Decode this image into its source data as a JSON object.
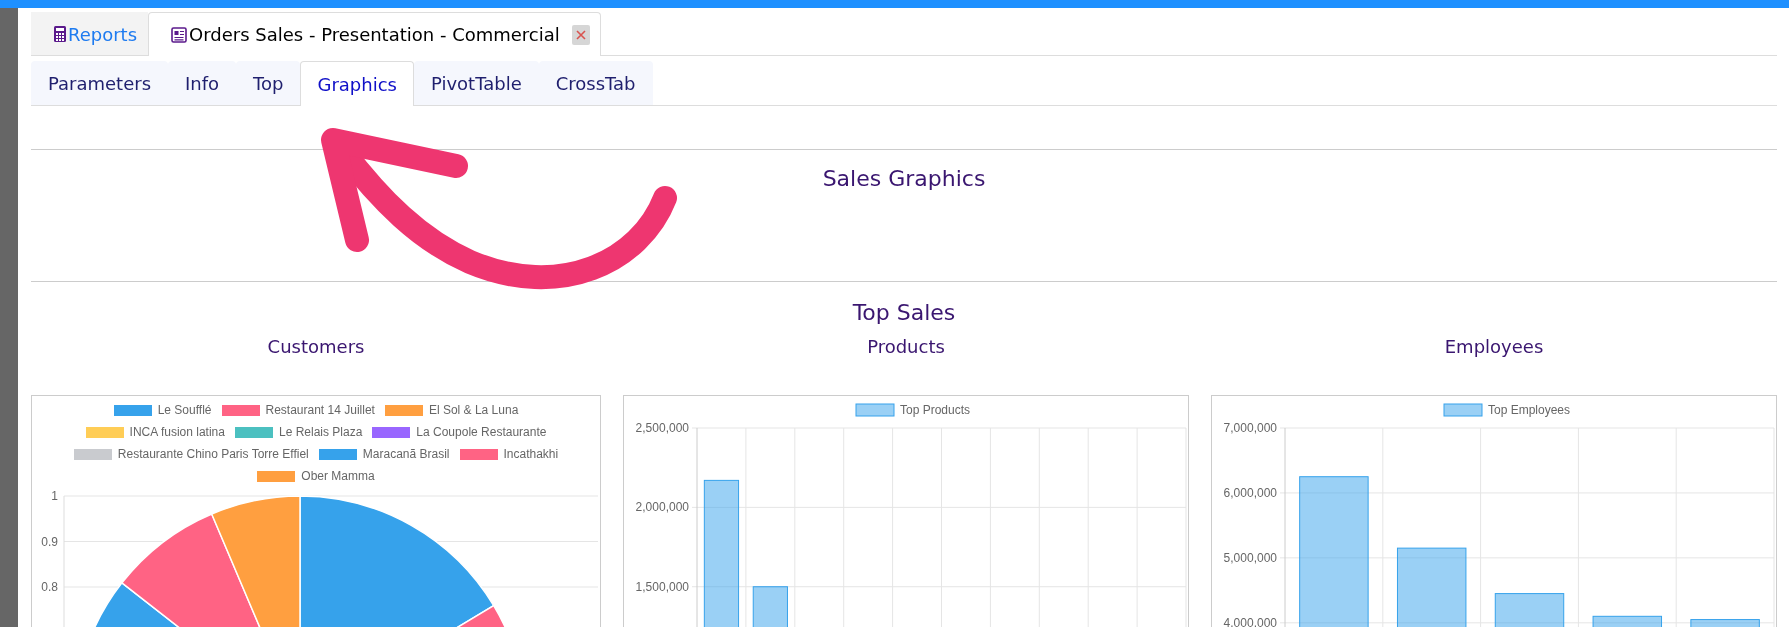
{
  "top_tabs": [
    {
      "label": "Reports",
      "selected": false,
      "closable": false
    },
    {
      "label": "Orders Sales - Presentation - Commercial",
      "selected": true,
      "closable": true
    }
  ],
  "sub_tabs": [
    {
      "label": "Parameters",
      "selected": false
    },
    {
      "label": "Info",
      "selected": false
    },
    {
      "label": "Top",
      "selected": false
    },
    {
      "label": "Graphics",
      "selected": true
    },
    {
      "label": "PivotTable",
      "selected": false
    },
    {
      "label": "CrossTab",
      "selected": false
    }
  ],
  "page_title": "Sales Graphics",
  "top_sales": {
    "title": "Top Sales",
    "customers": {
      "title": "Customers",
      "legend": [
        {
          "label": "Le Soufflé",
          "color": "#36a2eb"
        },
        {
          "label": "Restaurant 14 Juillet",
          "color": "#ff6384"
        },
        {
          "label": "El Sol & La Luna",
          "color": "#ff9f40"
        },
        {
          "label": "INCA fusion latina",
          "color": "#ffcd56"
        },
        {
          "label": "Le Relais Plaza",
          "color": "#4bc0c0"
        },
        {
          "label": "La Coupole Restaurante",
          "color": "#9966ff"
        },
        {
          "label": "Restaurante Chino Paris Torre Effiel",
          "color": "#c9cbcf"
        },
        {
          "label": "Maracanã Brasil",
          "color": "#36a2eb"
        },
        {
          "label": "Incathakhi",
          "color": "#ff6384"
        },
        {
          "label": "Ober Mamma",
          "color": "#ff9f40"
        }
      ],
      "axis_ticks": [
        "1",
        "0.9",
        "0.8"
      ]
    },
    "products": {
      "title": "Products",
      "chart_data": {
        "type": "bar",
        "grid": true,
        "ylim": [
          1240000,
          2500000
        ],
        "yticks": [
          {
            "value": 1500000,
            "label": "1,500,000"
          },
          {
            "value": 2000000,
            "label": "2,000,000"
          },
          {
            "value": 2500000,
            "label": "2,500,000"
          }
        ],
        "series": [
          {
            "name": "Top Products",
            "color": "#36a2eb",
            "values": [
              2170000,
              1500000,
              null,
              null,
              null,
              null,
              null,
              null,
              null,
              null
            ]
          }
        ]
      }
    },
    "employees": {
      "title": "Employees",
      "chart_data": {
        "type": "bar",
        "grid": true,
        "ylim": [
          3920000,
          7000000
        ],
        "yticks": [
          {
            "value": 4000000,
            "label": "4,000,000"
          },
          {
            "value": 5000000,
            "label": "5,000,000"
          },
          {
            "value": 6000000,
            "label": "6,000,000"
          },
          {
            "value": 7000000,
            "label": "7,000,000"
          }
        ],
        "series": [
          {
            "name": "Top Employees",
            "color": "#36a2eb",
            "values": [
              6250000,
              5150000,
              4450000,
              4100000,
              4050000
            ]
          }
        ]
      }
    }
  }
}
